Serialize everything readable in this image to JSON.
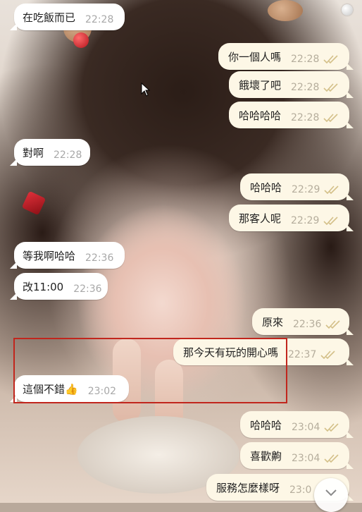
{
  "messages": [
    {
      "dir": "in",
      "text": "在吃飯而已",
      "time": "22:28"
    },
    {
      "dir": "out",
      "text": "你一個人嗎",
      "time": "22:28"
    },
    {
      "dir": "out",
      "text": "餓壞了吧",
      "time": "22:28"
    },
    {
      "dir": "out",
      "text": "哈哈哈哈",
      "time": "22:28"
    },
    {
      "dir": "in",
      "text": "對啊",
      "time": "22:28"
    },
    {
      "dir": "out",
      "text": "哈哈哈",
      "time": "22:29"
    },
    {
      "dir": "out",
      "text": "那客人呢",
      "time": "22:29"
    },
    {
      "dir": "in",
      "text": "等我啊哈哈",
      "time": "22:36"
    },
    {
      "dir": "in",
      "text": "改11:00",
      "time": "22:36"
    },
    {
      "dir": "out",
      "text": "原來",
      "time": "22:36"
    },
    {
      "dir": "out",
      "text": "那今天有玩的開心嗎",
      "time": "22:37"
    },
    {
      "dir": "in",
      "text": "這個不錯👍",
      "time": "23:02"
    },
    {
      "dir": "out",
      "text": "哈哈哈",
      "time": "23:04"
    },
    {
      "dir": "out",
      "text": "喜歡齁",
      "time": "23:04"
    },
    {
      "dir": "out",
      "text": "服務怎麼樣呀",
      "time": "23:0"
    }
  ],
  "colors": {
    "incoming_bubble": "#ffffff",
    "outgoing_bubble": "#fdf7e6",
    "read_ticks": "#d4c089",
    "highlight_box": "#c1261d"
  },
  "icons": {
    "read_receipt": "double-check-icon",
    "scroll_down": "chevron-down-icon",
    "cursor": "mouse-pointer-icon"
  }
}
